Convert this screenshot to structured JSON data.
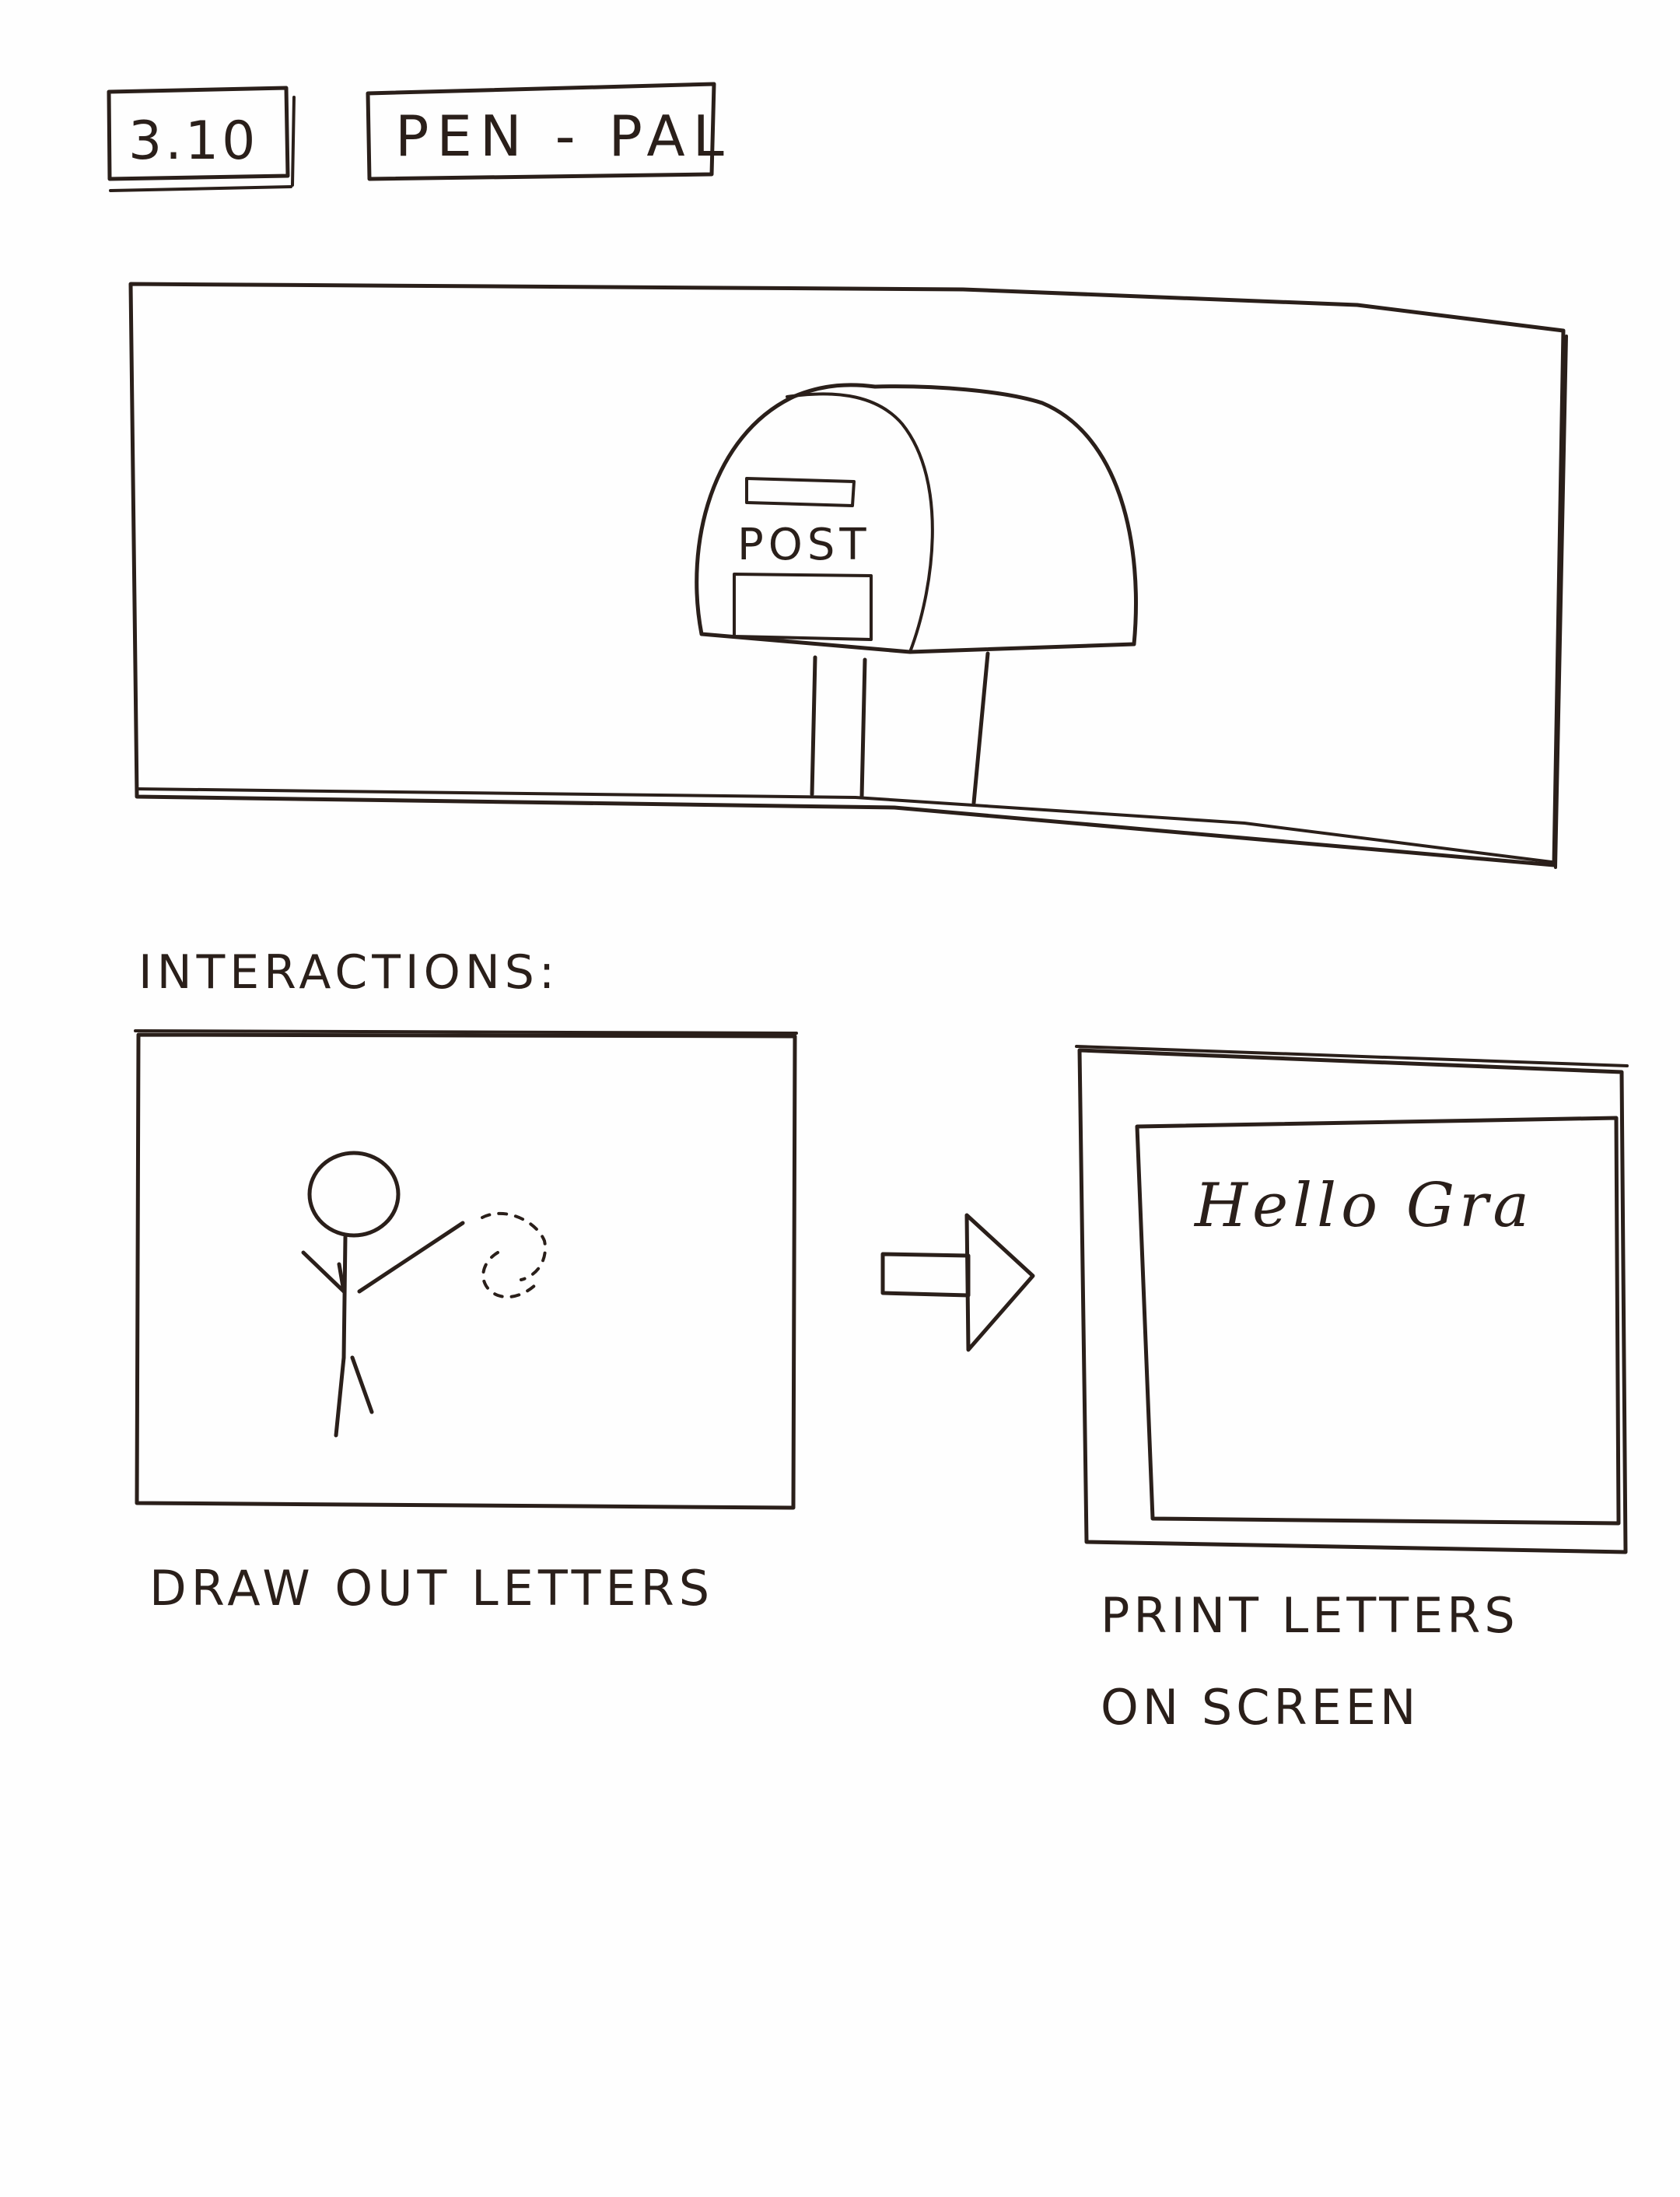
{
  "sketch": {
    "id": "3.10",
    "title": "PEN - PAL",
    "scene": {
      "mailbox_label": "POST"
    },
    "interactions_heading": "INTERACTIONS:",
    "panels": [
      {
        "caption": "DRAW OUT LETTERS"
      },
      {
        "screen_text": "Hello Gra",
        "caption": "PRINT LETTERS ON SCREEN"
      }
    ]
  },
  "colors": {
    "ink": "#2a1f1a",
    "paper": "#fefefe"
  },
  "icons": [
    "mailbox-icon",
    "stick-figure-icon",
    "arrow-right-icon"
  ]
}
